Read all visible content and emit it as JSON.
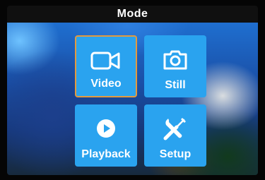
{
  "header": {
    "title": "Mode"
  },
  "tiles": [
    {
      "label": "Video",
      "icon": "video-camera-icon",
      "selected": true
    },
    {
      "label": "Still",
      "icon": "photo-camera-icon",
      "selected": false
    },
    {
      "label": "Playback",
      "icon": "play-icon",
      "selected": false
    },
    {
      "label": "Setup",
      "icon": "wrench-screwdriver-icon",
      "selected": false
    }
  ],
  "colors": {
    "tile": "#2aa3ef",
    "selection": "#e39a3e",
    "title_bar": "#101010",
    "text": "#ffffff"
  }
}
